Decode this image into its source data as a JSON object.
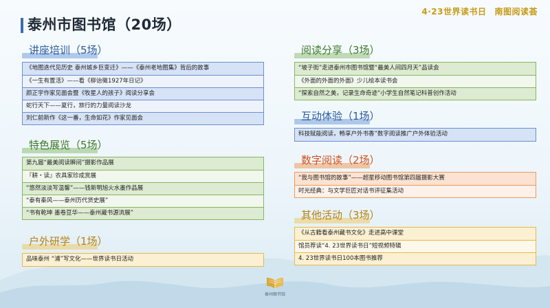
{
  "header": {
    "top_left_tag": "4·23世界读书日",
    "top_right_tag": "南图阅读荟",
    "title": "泰州市图书馆（20场）"
  },
  "sections": {
    "lectures": {
      "title": "讲座培训（5场）",
      "items": [
        "《地图迭代见历史  泰州城乡巨变迁》——《泰州老地图集》背后的故事",
        "《一生有置活》——看《柳诒徵1927年日记》",
        "颜正宇作家见面会暨《牧星人的孩子》阅读分享会",
        "蛇行天下——夏行，旅行的力量阅读沙龙",
        "刘仁前新作《这一番，生命如花》作家见面会"
      ]
    },
    "exhibitions": {
      "title": "特色展览（5场）",
      "items": [
        "第九届“最美阅读瞬间”摄影作品展",
        "『耕・读』农具家珍成赏展",
        "“悠然淡淡写温馨”——钱新明旭火水墨作品展",
        "“泰有秦风——泰州历代货史展”",
        "“书有乾坤  墨卷豆华——泰州藏书源流展”"
      ]
    },
    "outdoor": {
      "title": "户外研学（1场）",
      "items": [
        "品味泰州 “浦”写文化——世界读书日活动"
      ]
    },
    "sharing": {
      "title": "阅读分享（3场）",
      "items": [
        "“坡子街”走进泰州市图书馆暨“最美人间四月天”品读会",
        "《外面的外面的外面》少儿绘本读书会",
        "“探索自然之美，记录生命奇迹”小学生自然笔记科普创作活动"
      ]
    },
    "interactive": {
      "title": "互动体验（1场）",
      "items": [
        "科技赋能阅读，畅享户外书香”数字阅读推广户外体验活动"
      ]
    },
    "digital": {
      "title": "数字阅读（2场）",
      "items": [
        "“我与图书馆的故事”——超星移动图书馆第四届摄影大赛",
        "时光经典：与文学巨匠对话书评征集活动"
      ]
    },
    "other": {
      "title": "其他活动（3场）",
      "items": [
        "《从古籍看泰州藏书文化》走进高中课堂",
        "馆员荐读“4. 23世界读书日”短视频特辑",
        "4. 23世界读书日100本图书推荐"
      ]
    }
  },
  "logo": {
    "name": "泰州图书馆",
    "icon": "open-book-logo-icon"
  }
}
